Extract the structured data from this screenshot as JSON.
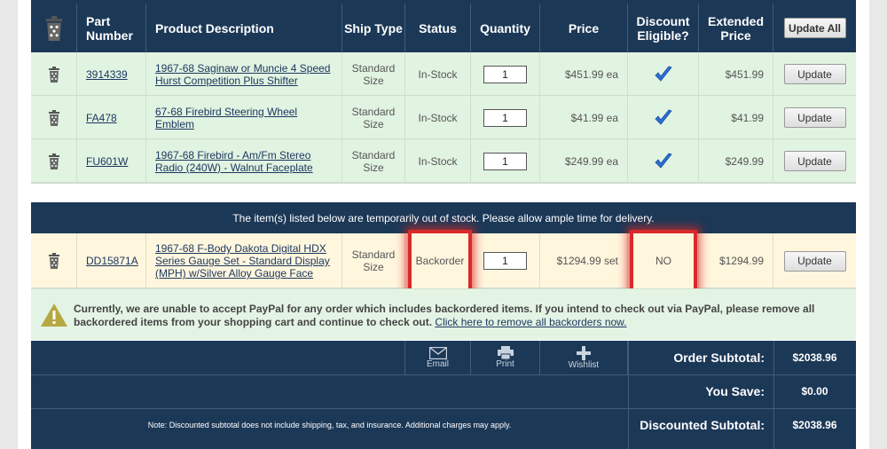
{
  "header": {
    "part_number": "Part Number",
    "product_description": "Product Description",
    "ship_type": "Ship Type",
    "status": "Status",
    "quantity": "Quantity",
    "price": "Price",
    "discount_eligible": "Discount Eligible?",
    "extended_price": "Extended Price",
    "update_all": "Update All"
  },
  "in_stock_rows": [
    {
      "part": "3914339",
      "description": "1967-68 Saginaw or Muncie 4 Speed Hurst Competition Plus Shifter",
      "ship_type": "Standard Size",
      "status": "In-Stock",
      "qty": "1",
      "price": "$451.99 ea",
      "extended": "$451.99",
      "update": "Update"
    },
    {
      "part": "FA478",
      "description": "67-68 Firebird Steering Wheel Emblem",
      "ship_type": "Standard Size",
      "status": "In-Stock",
      "qty": "1",
      "price": "$41.99 ea",
      "extended": "$41.99",
      "update": "Update"
    },
    {
      "part": "FU601W",
      "description": "1967-68 Firebird - Am/Fm Stereo Radio (240W) - Walnut Faceplate",
      "ship_type": "Standard Size",
      "status": "In-Stock",
      "qty": "1",
      "price": "$249.99 ea",
      "extended": "$249.99",
      "update": "Update"
    }
  ],
  "backorder_notice": "The item(s) listed below are temporarily out of stock. Please allow ample time for delivery.",
  "backorder_rows": [
    {
      "part": "DD15871A",
      "description": "1967-68 F-Body Dakota Digital HDX Series Gauge Set - Standard Display (MPH) w/Silver Alloy Gauge Face",
      "ship_type": "Standard Size",
      "status": "Backorder",
      "qty": "1",
      "price": "$1294.99 set",
      "discount": "NO",
      "extended": "$1294.99",
      "update": "Update"
    }
  ],
  "paypal_warning": {
    "text": "Currently, we are unable to accept PayPal for any order which includes backordered items. If you intend to check out via PayPal, please remove all backordered items from your shopping cart and continue to check out.",
    "link": "Click here to remove all backorders now."
  },
  "tools": {
    "email": "Email",
    "print": "Print",
    "wishlist": "Wishlist"
  },
  "totals": {
    "order_subtotal_label": "Order Subtotal:",
    "order_subtotal": "$2038.96",
    "you_save_label": "You Save:",
    "you_save": "$0.00",
    "discounted_label": "Discounted Subtotal:",
    "discounted": "$2038.96"
  },
  "note": "Note: Discounted subtotal does not include shipping, tax, and insurance. Additional charges may apply.",
  "colors": {
    "navy": "#1c3857",
    "in_stock_row": "#e1f3e1",
    "backorder_row": "#fff6de",
    "highlight": "#d82a2a",
    "check": "#2a6fd6"
  }
}
